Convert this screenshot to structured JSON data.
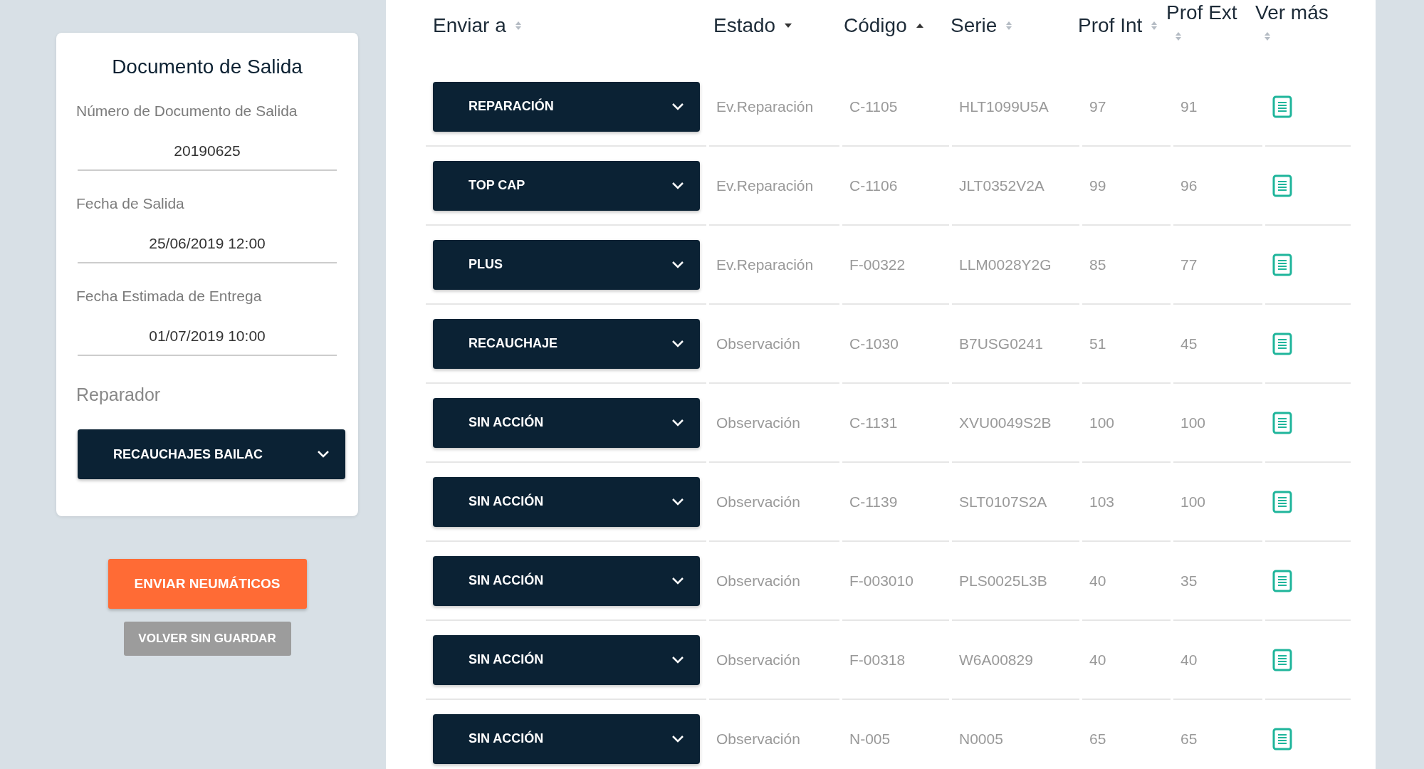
{
  "document_card": {
    "title": "Documento de Salida",
    "fields": [
      {
        "label": "Número de Documento de Salida",
        "value": "20190625"
      },
      {
        "label": "Fecha de Salida",
        "value": "25/06/2019 12:00"
      },
      {
        "label": "Fecha Estimada de Entrega",
        "value": "01/07/2019 10:00"
      }
    ],
    "repairer": {
      "label": "Reparador",
      "value": "RECAUCHAJES BAILAC"
    }
  },
  "buttons": {
    "primary": "ENVIAR NEUMÁTICOS",
    "secondary": "VOLVER SIN GUARDAR"
  },
  "table": {
    "columns": [
      {
        "label": "Enviar a",
        "sorted": false
      },
      {
        "label": "Estado",
        "sorted": true,
        "descending": true
      },
      {
        "label": "Código",
        "sorted": true,
        "descending": false
      },
      {
        "label": "Serie",
        "sorted": false
      },
      {
        "label": "Prof Int",
        "sorted": false
      },
      {
        "label": "Prof Ext",
        "sorted": false
      },
      {
        "label": "Ver más",
        "sorted": false
      }
    ],
    "rows": [
      {
        "send_to": "REPARACIÓN",
        "status": "Ev.Reparación",
        "code": "C-1105",
        "serial": "HLT1099U5A",
        "prof_int": "97",
        "prof_ext": "91"
      },
      {
        "send_to": "TOP CAP",
        "status": "Ev.Reparación",
        "code": "C-1106",
        "serial": "JLT0352V2A",
        "prof_int": "99",
        "prof_ext": "96"
      },
      {
        "send_to": "PLUS",
        "status": "Ev.Reparación",
        "code": "F-00322",
        "serial": "LLM0028Y2G",
        "prof_int": "85",
        "prof_ext": "77"
      },
      {
        "send_to": "RECAUCHAJE",
        "status": "Observación",
        "code": "C-1030",
        "serial": "B7USG0241",
        "prof_int": "51",
        "prof_ext": "45"
      },
      {
        "send_to": "SIN ACCIÓN",
        "status": "Observación",
        "code": "C-1131",
        "serial": "XVU0049S2B",
        "prof_int": "100",
        "prof_ext": "100"
      },
      {
        "send_to": "SIN ACCIÓN",
        "status": "Observación",
        "code": "C-1139",
        "serial": "SLT0107S2A",
        "prof_int": "103",
        "prof_ext": "100"
      },
      {
        "send_to": "SIN ACCIÓN",
        "status": "Observación",
        "code": "F-003010",
        "serial": "PLS0025L3B",
        "prof_int": "40",
        "prof_ext": "35"
      },
      {
        "send_to": "SIN ACCIÓN",
        "status": "Observación",
        "code": "F-00318",
        "serial": "W6A00829",
        "prof_int": "40",
        "prof_ext": "40"
      },
      {
        "send_to": "SIN ACCIÓN",
        "status": "Observación",
        "code": "N-005",
        "serial": "N0005",
        "prof_int": "65",
        "prof_ext": "65"
      }
    ]
  }
}
